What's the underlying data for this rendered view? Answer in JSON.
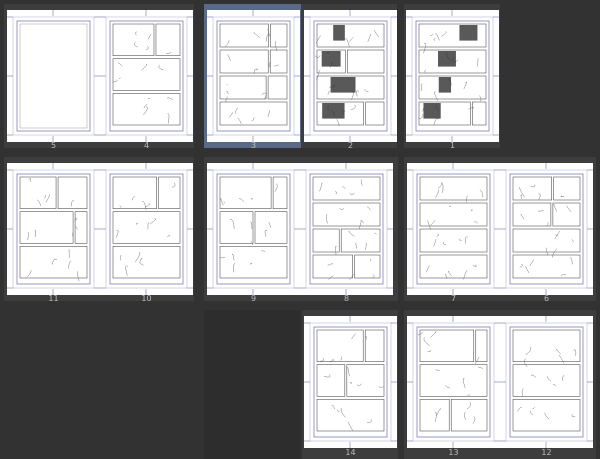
{
  "pages": [
    {
      "number": "5",
      "art": "blank",
      "selected": false
    },
    {
      "number": "4",
      "art": "sketch",
      "selected": false
    },
    {
      "number": "3",
      "art": "sketch",
      "selected": true
    },
    {
      "number": "2",
      "art": "inked",
      "selected": false
    },
    {
      "number": "1",
      "art": "inked",
      "selected": false
    },
    {
      "number": "11",
      "art": "sketch",
      "selected": false
    },
    {
      "number": "10",
      "art": "sketch",
      "selected": false
    },
    {
      "number": "9",
      "art": "sketch",
      "selected": false
    },
    {
      "number": "8",
      "art": "sketch",
      "selected": false
    },
    {
      "number": "7",
      "art": "sketch",
      "selected": false
    },
    {
      "number": "6",
      "art": "sketch",
      "selected": false
    },
    {
      "number": "14",
      "art": "sketch",
      "selected": false
    },
    {
      "number": "13",
      "art": "sketch",
      "selected": false
    },
    {
      "number": "12",
      "art": "sketch",
      "selected": false
    }
  ],
  "colors": {
    "background": "#323232",
    "spread": "#3d3d3d",
    "selected": "#5a6a86",
    "guide": "#6f6fa8"
  }
}
